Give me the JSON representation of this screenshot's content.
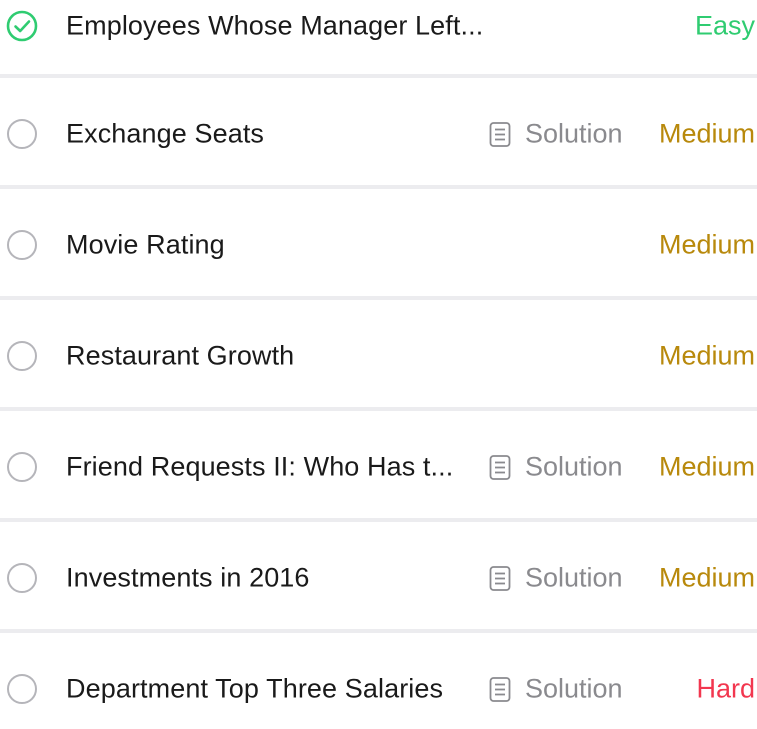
{
  "colors": {
    "easy": "#2fcc71",
    "medium": "#b8890c",
    "hard": "#f2374f",
    "solved_check": "#2fcc71",
    "unsolved_ring": "#b5b5ba"
  },
  "problems": [
    {
      "title": "Employees Whose Manager Left...",
      "solved": true,
      "solution_label": "",
      "difficulty": "Easy"
    },
    {
      "title": "Exchange Seats",
      "solved": false,
      "solution_label": "Solution",
      "difficulty": "Medium"
    },
    {
      "title": "Movie Rating",
      "solved": false,
      "solution_label": "",
      "difficulty": "Medium"
    },
    {
      "title": "Restaurant Growth",
      "solved": false,
      "solution_label": "",
      "difficulty": "Medium"
    },
    {
      "title": "Friend Requests II: Who Has t...",
      "solved": false,
      "solution_label": "Solution",
      "difficulty": "Medium"
    },
    {
      "title": "Investments in 2016",
      "solved": false,
      "solution_label": "Solution",
      "difficulty": "Medium"
    },
    {
      "title": "Department Top Three Salaries",
      "solved": false,
      "solution_label": "Solution",
      "difficulty": "Hard"
    }
  ]
}
